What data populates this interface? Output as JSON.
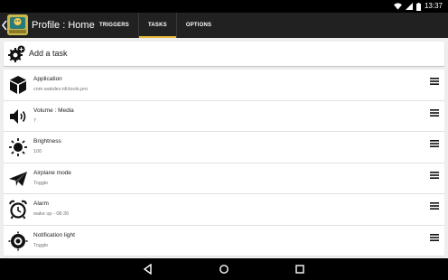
{
  "status": {
    "time": "13:37"
  },
  "appbar": {
    "title": "Profile : Home"
  },
  "tabs": [
    {
      "label": "TRIGGERS",
      "active": false
    },
    {
      "label": "TASKS",
      "active": true
    },
    {
      "label": "OPTIONS",
      "active": false
    }
  ],
  "add_task": {
    "label": "Add a task"
  },
  "tasks": [
    {
      "title": "Application",
      "subtitle": "com.wakdev.nfctools.pro",
      "icon": "cube-icon"
    },
    {
      "title": "Volume : Media",
      "subtitle": "7",
      "icon": "speaker-icon"
    },
    {
      "title": "Brightness",
      "subtitle": "100",
      "icon": "sun-icon"
    },
    {
      "title": "Airplane mode",
      "subtitle": "Toggle",
      "icon": "paper-plane-icon"
    },
    {
      "title": "Alarm",
      "subtitle": "wake up - 08:30",
      "icon": "alarm-clock-icon"
    },
    {
      "title": "Notification light",
      "subtitle": "Toggle",
      "icon": "notification-light-icon"
    }
  ],
  "colors": {
    "appbar": "#212121",
    "tab_indicator": "#e8b838",
    "background": "#eeeeee"
  }
}
